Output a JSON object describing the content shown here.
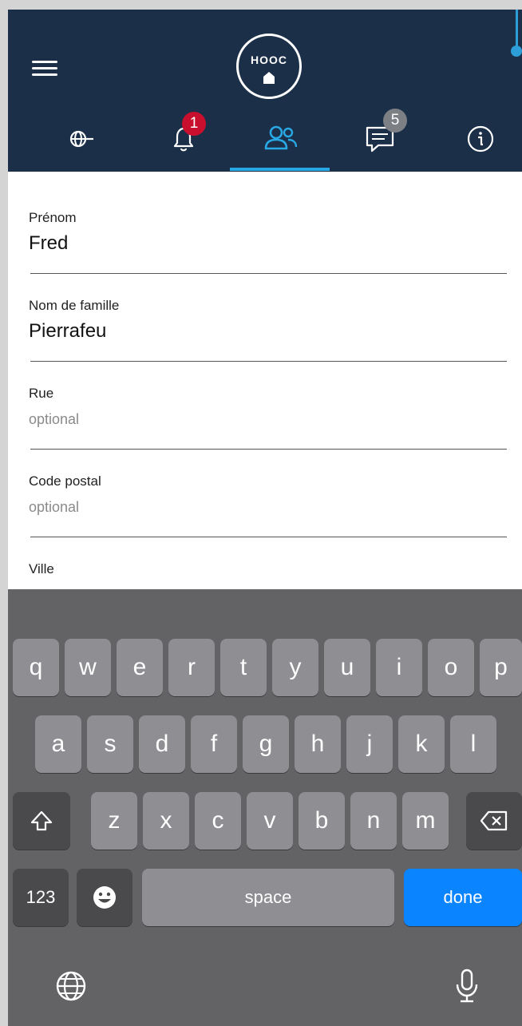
{
  "header": {
    "logo_text": "HOOC",
    "tabs": [
      {
        "name": "network",
        "active": false
      },
      {
        "name": "notifications",
        "badge": "1",
        "active": false
      },
      {
        "name": "users",
        "active": true
      },
      {
        "name": "messages",
        "badge": "5",
        "active": false
      },
      {
        "name": "info",
        "active": false
      }
    ],
    "colors": {
      "header_bg": "#1b2f48",
      "accent": "#29a8e6",
      "badge_red": "#c8102e",
      "badge_gray": "#7c7f84"
    }
  },
  "form": {
    "fields": [
      {
        "label": "Prénom",
        "value": "Fred",
        "placeholder": ""
      },
      {
        "label": "Nom de famille",
        "value": "Pierrafeu",
        "placeholder": ""
      },
      {
        "label": "Rue",
        "value": "",
        "placeholder": "optional"
      },
      {
        "label": "Code postal",
        "value": "",
        "placeholder": "optional"
      },
      {
        "label": "Ville",
        "value": "",
        "placeholder": ""
      }
    ]
  },
  "keyboard": {
    "row1": [
      "q",
      "w",
      "e",
      "r",
      "t",
      "y",
      "u",
      "i",
      "o",
      "p"
    ],
    "row2": [
      "a",
      "s",
      "d",
      "f",
      "g",
      "h",
      "j",
      "k",
      "l"
    ],
    "row3": [
      "z",
      "x",
      "c",
      "v",
      "b",
      "n",
      "m"
    ],
    "numbers_label": "123",
    "space_label": "space",
    "done_label": "done",
    "icons": {
      "shift": "shift-icon",
      "backspace": "backspace-icon",
      "emoji": "emoji-icon",
      "globe": "globe-icon",
      "mic": "microphone-icon"
    }
  }
}
